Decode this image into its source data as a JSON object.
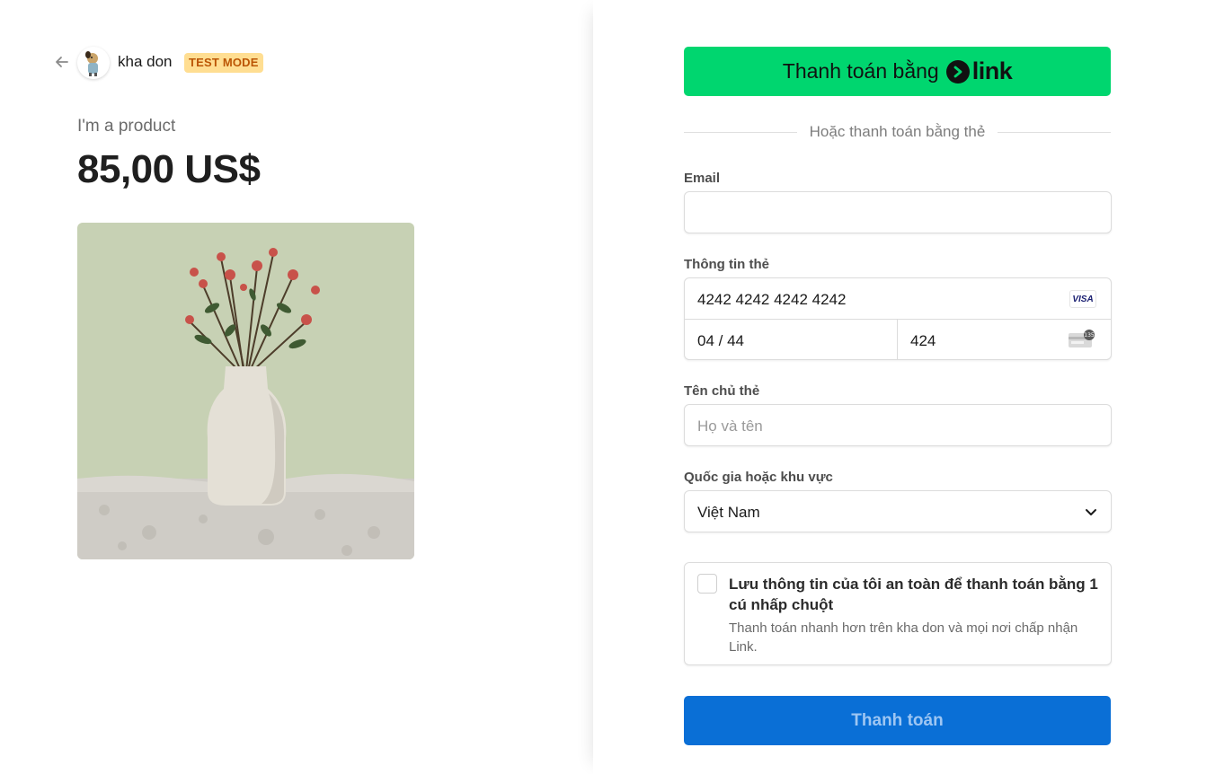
{
  "header": {
    "merchant_name": "kha don",
    "test_mode_badge": "TEST MODE"
  },
  "product": {
    "name": "I'm a product",
    "price": "85,00 US$"
  },
  "link_button": {
    "label": "Thanh toán bằng",
    "logo_word": "link",
    "color": "#00d66f"
  },
  "divider_text": "Hoặc thanh toán bằng thẻ",
  "email": {
    "label": "Email",
    "value": ""
  },
  "card": {
    "label": "Thông tin thẻ",
    "number": "4242 4242 4242 4242",
    "brand": "VISA",
    "expiry": "04 / 44",
    "cvc": "424",
    "cvc_icon_text": "135"
  },
  "cardholder": {
    "label": "Tên chủ thẻ",
    "placeholder": "Họ và tên"
  },
  "country": {
    "label": "Quốc gia hoặc khu vực",
    "selected": "Việt Nam"
  },
  "save_info": {
    "title": "Lưu thông tin của tôi an toàn để thanh toán bằng 1 cú nhấp chuột",
    "description": "Thanh toán nhanh hơn trên kha don và mọi nơi chấp nhận Link.",
    "checked": false
  },
  "pay_button": {
    "label": "Thanh toán",
    "color": "#0a6fd6"
  },
  "icons": [
    "back-arrow-icon",
    "avatar",
    "link-logo-icon",
    "visa-icon",
    "cvc-card-icon",
    "chevron-down-icon"
  ]
}
